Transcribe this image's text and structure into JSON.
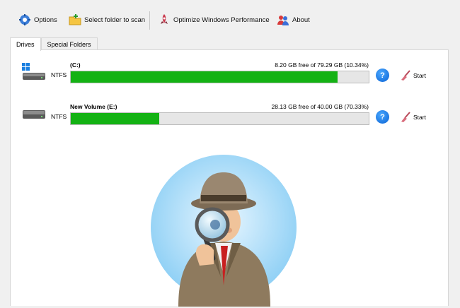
{
  "toolbar": {
    "options_label": "Options",
    "select_folder_label": "Select folder to scan",
    "optimize_label": "Optimize Windows Performance",
    "about_label": "About"
  },
  "tabs": [
    {
      "label": "Drives",
      "active": true
    },
    {
      "label": "Special Folders",
      "active": false
    }
  ],
  "drives": [
    {
      "name": "(C:)",
      "filesystem": "NTFS",
      "free_text": "8.20 GB free of 79.29 GB (10.34%)",
      "used_fraction": 0.8966,
      "action_label": "Start",
      "help_label": "?"
    },
    {
      "name": "New Volume (E:)",
      "filesystem": "NTFS",
      "free_text": "28.13 GB free of 40.00 GB (70.33%)",
      "used_fraction": 0.2967,
      "action_label": "Start",
      "help_label": "?"
    }
  ],
  "colors": {
    "bar_fill": "#14b214",
    "bar_bg": "#e6e6e6",
    "help_blue": "#0a62d4"
  },
  "icons": [
    "options-icon",
    "folder-icon",
    "rocket-icon",
    "about-icon",
    "windows-drive-icon",
    "drive-icon",
    "help-icon",
    "broom-icon"
  ],
  "illustration": "detective-with-magnifier"
}
